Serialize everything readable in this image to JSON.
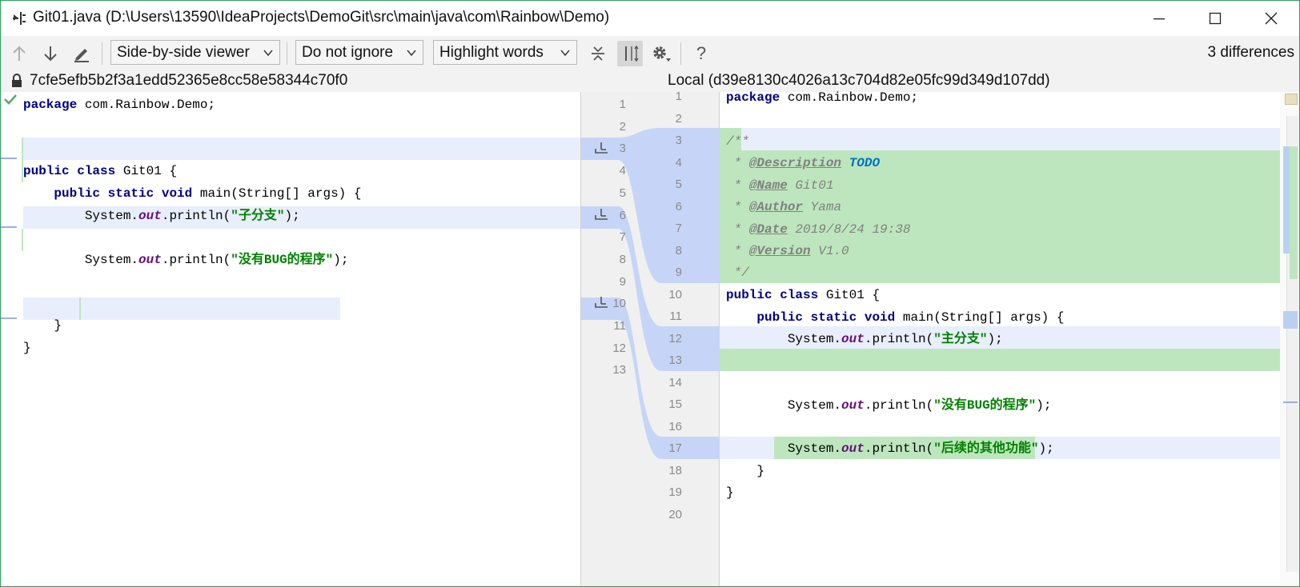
{
  "window": {
    "title": "Git01.java (D:\\Users\\13590\\IdeaProjects\\DemoGit\\src\\main\\java\\com\\Rainbow\\Demo)"
  },
  "toolbar": {
    "viewer": "Side-by-side viewer",
    "ignore": "Do not ignore",
    "highlight": "Highlight words",
    "help": "?",
    "differences": "3 differences"
  },
  "left": {
    "header": "7cfe5efb5b2f3a1edd52365e8cc58e58344c70f0",
    "lines": {
      "l1a": "package",
      "l1b": " com.Rainbow.Demo;",
      "l4a": "public",
      "l4b": " ",
      "l4c": "class",
      "l4d": " Git01 {",
      "l5a": "    ",
      "l5b": "public",
      "l5c": " ",
      "l5d": "static",
      "l5e": " ",
      "l5f": "void",
      "l5g": " main(String[] args) {",
      "l6a": "        System.",
      "l6b": "out",
      "l6c": ".println(",
      "l6d": "\"子分支\"",
      "l6e": ");",
      "l8a": "        System.",
      "l8b": "out",
      "l8c": ".println(",
      "l8d": "\"没有BUG的程序\"",
      "l8e": ");",
      "l11": "    }",
      "l12": "}"
    }
  },
  "middle": {
    "left_numbers": [
      "1",
      "2",
      "3",
      "4",
      "5",
      "6",
      "7",
      "8",
      "9",
      "10",
      "11",
      "12",
      "13"
    ],
    "right_numbers": [
      "1",
      "2",
      "3",
      "4",
      "5",
      "6",
      "7",
      "8",
      "9",
      "10",
      "11",
      "12",
      "13",
      "14",
      "15",
      "16",
      "17",
      "18",
      "19",
      "20"
    ]
  },
  "right": {
    "header": "Local (d39e8130c4026a13c704d82e05fc99d349d107dd)",
    "lines": {
      "r1a": "package",
      "r1b": " com.Rainbow.Demo;",
      "r3": "/**",
      "r4a": " * ",
      "r4b": "@Description",
      "r4c": " ",
      "r4d": "TODO",
      "r5a": " * ",
      "r5b": "@Name",
      "r5c": " Git01",
      "r6a": " * ",
      "r6b": "@Author",
      "r6c": " Yama",
      "r7a": " * ",
      "r7b": "@Date",
      "r7c": " 2019/8/24 19:38",
      "r8a": " * ",
      "r8b": "@Version",
      "r8c": " V1.0",
      "r9": " */",
      "r10a": "public",
      "r10b": " ",
      "r10c": "class",
      "r10d": " Git01 {",
      "r11a": "    ",
      "r11b": "public",
      "r11c": " ",
      "r11d": "static",
      "r11e": " ",
      "r11f": "void",
      "r11g": " main(String[] args) {",
      "r12a": "        System.",
      "r12b": "out",
      "r12c": ".println(",
      "r12d": "\"主分支\"",
      "r12e": ");",
      "r15a": "        System.",
      "r15b": "out",
      "r15c": ".println(",
      "r15d": "\"没有BUG的程序\"",
      "r15e": ");",
      "r17a": "        System.",
      "r17b": "out",
      "r17c": ".println(",
      "r17d": "\"后续的其他功能\"",
      "r17e": ");",
      "r18": "    }",
      "r19": "}"
    }
  },
  "colors": {
    "changed": "#c6d5f7",
    "inserted": "#bee6be",
    "changed_light": "#e8eefc"
  }
}
